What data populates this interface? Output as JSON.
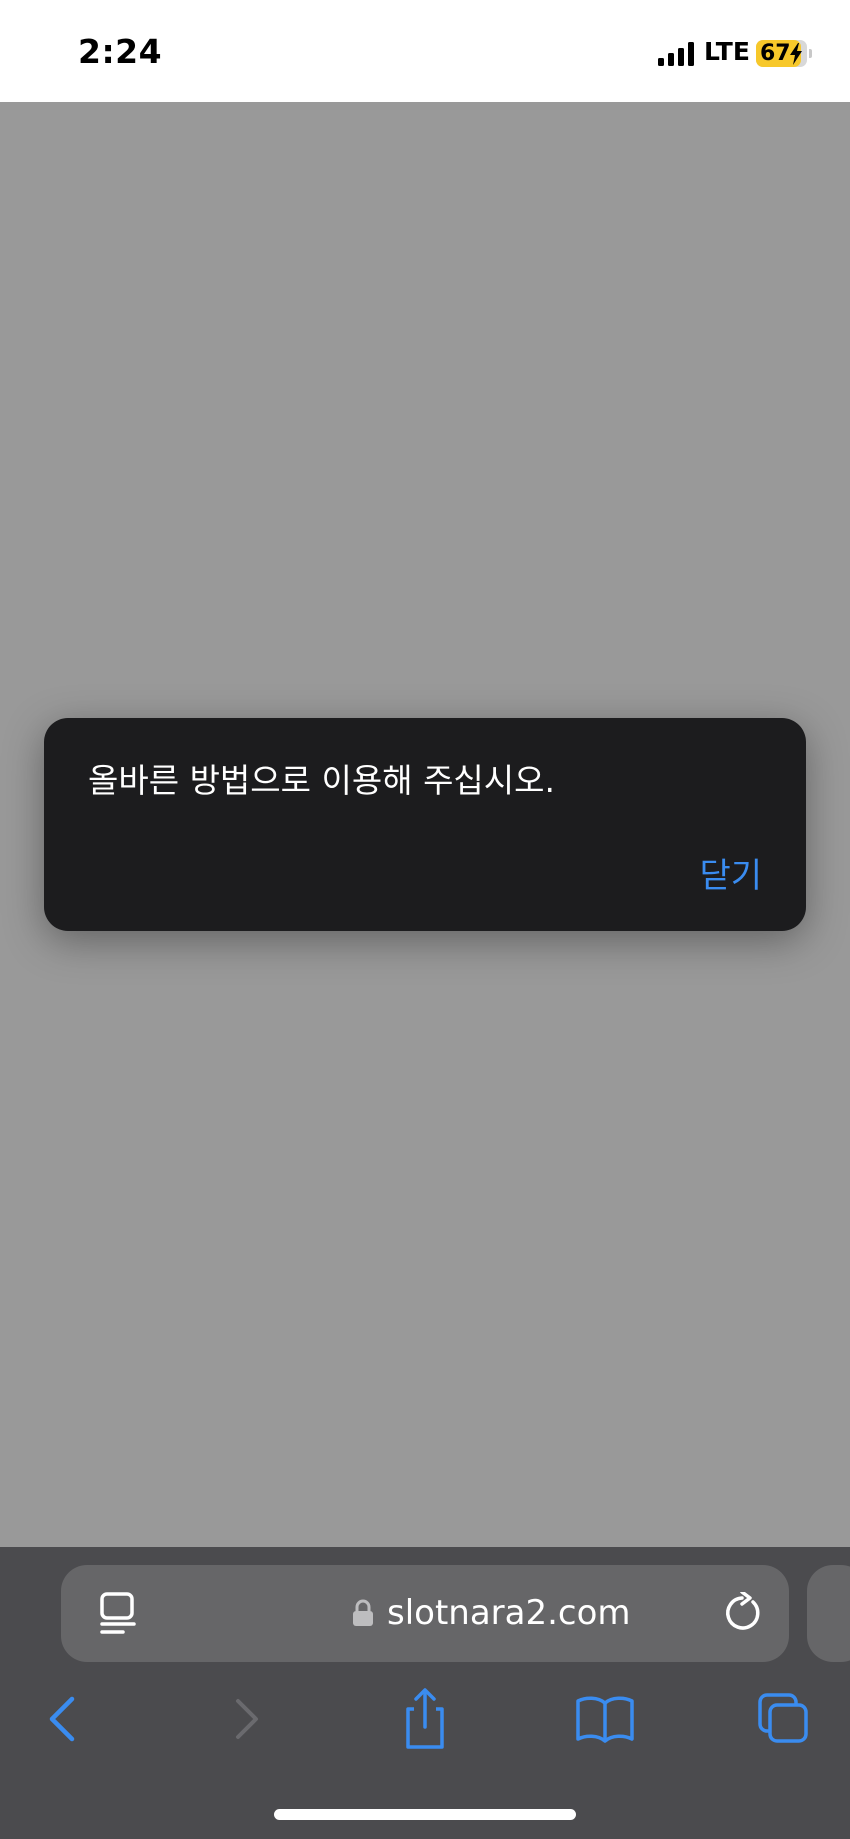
{
  "status_bar": {
    "time": "2:24",
    "network": "LTE",
    "battery": "67",
    "battery_color": "#f7c82a",
    "icons": [
      "signal-icon",
      "battery-icon",
      "charging-bolt-icon"
    ]
  },
  "alert": {
    "message": "올바른 방법으로 이용해 주십시오.",
    "close_label": "닫기",
    "accent_color": "#3a8cf0"
  },
  "browser": {
    "url": "slotnara2.com",
    "icons": [
      "reader-icon",
      "lock-icon",
      "reload-icon"
    ]
  },
  "toolbar": {
    "icons": [
      "back-icon",
      "forward-icon",
      "share-icon",
      "bookmarks-icon",
      "tabs-icon"
    ]
  }
}
